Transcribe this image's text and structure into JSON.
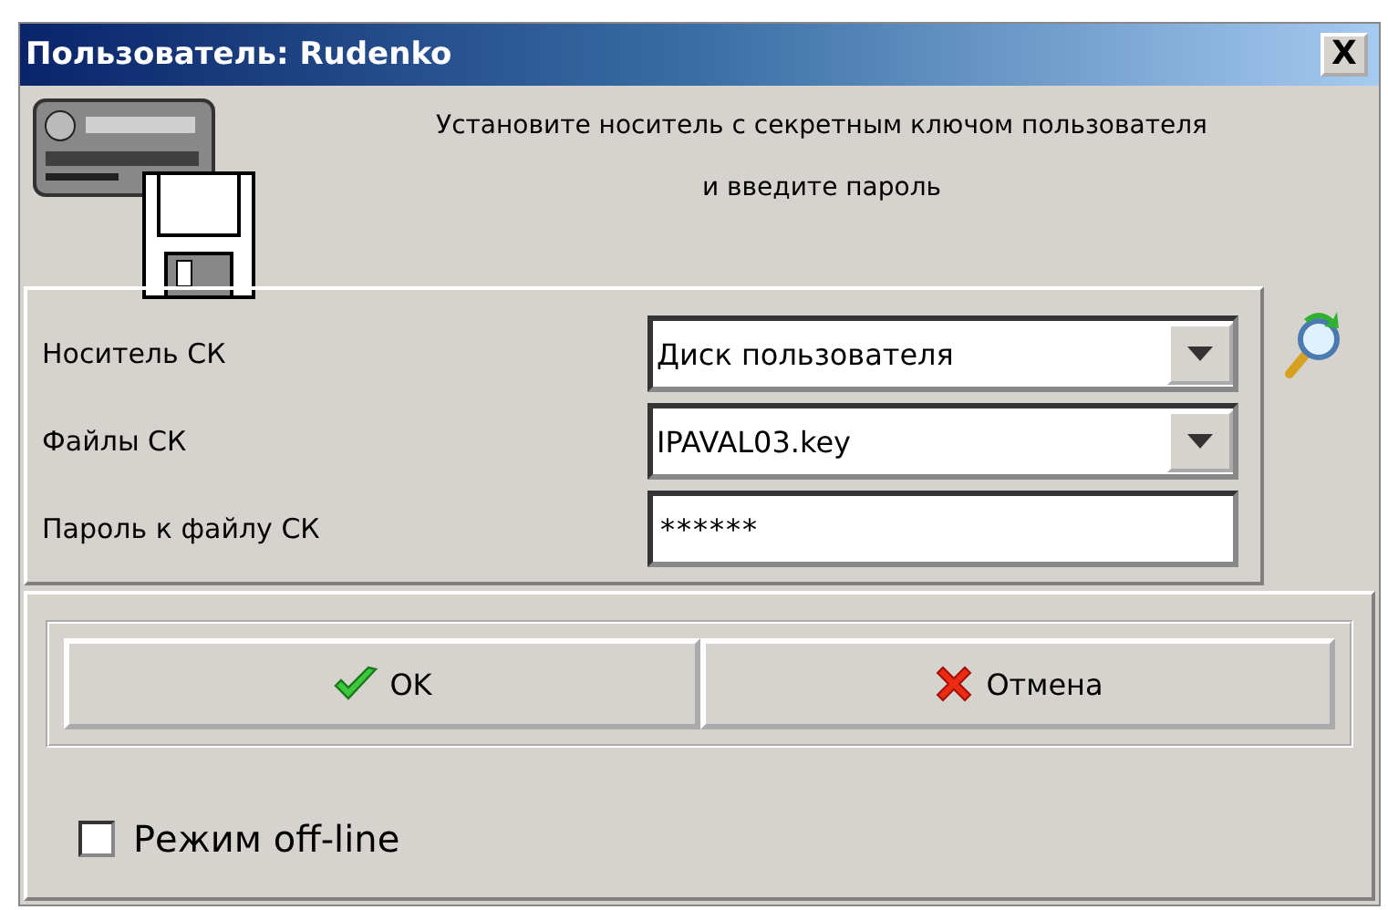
{
  "window": {
    "title": "Пользователь: Rudenko",
    "close_label": "X"
  },
  "message": {
    "line_1": "Установите носитель с секретным  ключом пользователя",
    "line_2": "и введите пароль"
  },
  "fields": [
    {
      "kind": "dropdown",
      "label": "Носитель СК",
      "value": "Диск пользователя"
    },
    {
      "kind": "dropdown",
      "label": "Файлы СК",
      "value": "IPAVAL03.key"
    },
    {
      "kind": "password",
      "label": "Пароль к файлу СК",
      "value": "******"
    }
  ],
  "buttons": [
    {
      "kind": "ok",
      "label": "OK"
    },
    {
      "kind": "cancel",
      "label": "Отмена"
    }
  ],
  "offline": {
    "label": "Режим off-line",
    "checked": false
  }
}
